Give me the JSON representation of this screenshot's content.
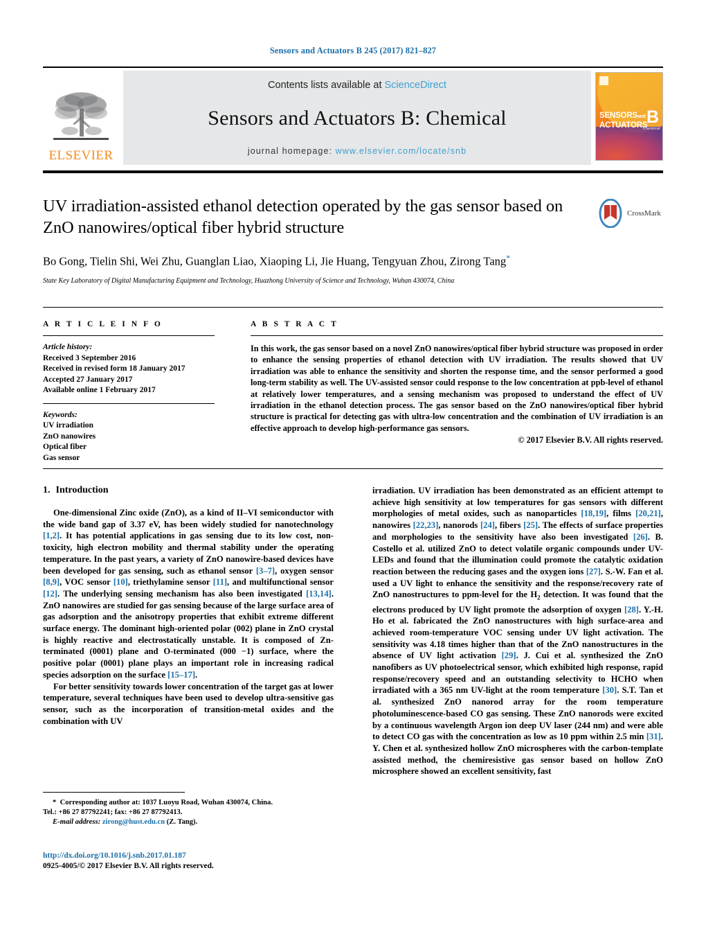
{
  "running_head": "Sensors and Actuators B 245 (2017) 821–827",
  "masthead": {
    "publisher": "ELSEVIER",
    "contents_prefix": "Contents lists available at ",
    "contents_link": "ScienceDirect",
    "journal_title": "Sensors and Actuators B: Chemical",
    "homepage_prefix": "journal homepage: ",
    "homepage_url": "www.elsevier.com/locate/snb",
    "cover": {
      "line1": "SENSORS",
      "line1_small": "and",
      "line2": "ACTUATORS",
      "letter": "B",
      "letter_sub": "Chemical"
    },
    "link_color": "#3f9fd0"
  },
  "article": {
    "title": "UV irradiation-assisted ethanol detection operated by the gas sensor based on ZnO nanowires/optical fiber hybrid structure",
    "authors": "Bo Gong, Tielin Shi, Wei Zhu, Guanglan Liao, Xiaoping Li, Jie Huang, Tengyuan Zhou, Zirong Tang",
    "corresponding_marker": "*",
    "affiliation": "State Key Laboratory of Digital Manufacturing Equipment and Technology, Huazhong University of Science and Technology, Wuhan 430074, China",
    "crossmark_label": "CrossMark"
  },
  "article_info": {
    "heading": "A R T I C L E   I N F O",
    "history_label": "Article history:",
    "history": [
      "Received 3 September 2016",
      "Received in revised form 18 January 2017",
      "Accepted 27 January 2017",
      "Available online 1 February 2017"
    ],
    "keywords_label": "Keywords:",
    "keywords": [
      "UV irradiation",
      "ZnO nanowires",
      "Optical fiber",
      "Gas sensor"
    ]
  },
  "abstract": {
    "heading": "A B S T R A C T",
    "text": "In this work, the gas sensor based on a novel ZnO nanowires/optical fiber hybrid structure was proposed in order to enhance the sensing properties of ethanol detection with UV irradiation. The results showed that UV irradiation was able to enhance the sensitivity and shorten the response time, and the sensor performed a good long-term stability as well. The UV-assisted sensor could response to the low concentration at ppb-level of ethanol at relatively lower temperatures, and a sensing mechanism was proposed to understand the effect of UV irradiation in the ethanol detection process. The gas sensor based on the ZnO nanowires/optical fiber hybrid structure is practical for detecting gas with ultra-low concentration and the combination of UV irradiation is an effective approach to develop high-performance gas sensors.",
    "copyright": "© 2017 Elsevier B.V. All rights reserved."
  },
  "body": {
    "section_number": "1.",
    "section_title": "Introduction",
    "left_paragraph_1_a": "One-dimensional Zinc oxide (ZnO), as a kind of II–VI semiconductor with the wide band gap of 3.37 eV, has been widely studied for nanotechnology ",
    "ref_1_2": "[1,2]",
    "left_paragraph_1_b": ". It has potential applications in gas sensing due to its low cost, non-toxicity, high electron mobility and thermal stability under the operating temperature. In the past years, a variety of ZnO nanowire-based devices have been developed for gas sensing, such as ethanol sensor ",
    "ref_3_7": "[3–7]",
    "left_paragraph_1_c": ", oxygen sensor ",
    "ref_8_9": "[8,9]",
    "left_paragraph_1_d": ", VOC sensor ",
    "ref_10": "[10]",
    "left_paragraph_1_e": ", triethylamine sensor ",
    "ref_11": "[11]",
    "left_paragraph_1_f": ", and multifunctional sensor ",
    "ref_12": "[12]",
    "left_paragraph_1_g": ". The underlying sensing mechanism has also been investigated ",
    "ref_13_14": "[13,14]",
    "left_paragraph_1_h": ". ZnO nanowires are studied for gas sensing because of the large surface area of gas adsorption and the anisotropy properties that exhibit extreme different surface energy. The dominant high-oriented polar (002) plane in ZnO crystal is highly reactive and electrostatically unstable. It is composed of Zn-terminated (0001) plane and O-terminated (000 −1) surface, where the positive polar (0001) plane plays an important role in increasing radical species adsorption on the surface ",
    "ref_15_17": "[15–17]",
    "left_paragraph_1_i": ".",
    "left_paragraph_2": "For better sensitivity towards lower concentration of the target gas at lower temperature, several techniques have been used to develop ultra-sensitive gas sensor, such as the incorporation of transition-metal oxides and the combination with UV",
    "right_paragraph_a": "irradiation. UV irradiation has been demonstrated as an efficient attempt to achieve high sensitivity at low temperatures for gas sensors with different morphologies of metal oxides, such as nanoparticles ",
    "ref_18_19": "[18,19]",
    "right_paragraph_b": ", films ",
    "ref_20_21": "[20,21]",
    "right_paragraph_c": ", nanowires ",
    "ref_22_23": "[22,23]",
    "right_paragraph_d": ", nanorods ",
    "ref_24": "[24]",
    "right_paragraph_e": ", fibers ",
    "ref_25": "[25]",
    "right_paragraph_f": ". The effects of surface properties and morphologies to the sensitivity have also been investigated ",
    "ref_26": "[26]",
    "right_paragraph_g": ". B. Costello et al. utilized ZnO to detect volatile organic compounds under UV-LEDs and found that the illumination could promote the catalytic oxidation reaction between the reducing gases and the oxygen ions ",
    "ref_27": "[27]",
    "right_paragraph_h": ". S.-W. Fan et al. used a UV light to enhance the sensitivity and the response/recovery rate of ZnO nanostructures to ppm-level for the H",
    "h2_sub": "2",
    "right_paragraph_i": " detection. It was found that the electrons produced by UV light promote the adsorption of oxygen ",
    "ref_28": "[28]",
    "right_paragraph_j": ". Y.-H. Ho et al. fabricated the ZnO nanostructures with high surface-area and achieved room-temperature VOC sensing under UV light activation. The sensitivity was 4.18 times higher than that of the ZnO nanostructures in the absence of UV light activation ",
    "ref_29": "[29]",
    "right_paragraph_k": ". J. Cui et al. synthesized the ZnO nanofibers as UV photoelectrical sensor, which exhibited high response, rapid response/recovery speed and an outstanding selectivity to HCHO when irradiated with a 365 nm UV-light at the room temperature ",
    "ref_30": "[30]",
    "right_paragraph_l": ". S.T. Tan et al. synthesized ZnO nanorod array for the room temperature photoluminescence-based CO gas sensing. These ZnO nanorods were excited by a continuous wavelength Argon ion deep UV laser (244 nm) and were able to detect CO gas with the concentration as low as 10 ppm within 2.5 min ",
    "ref_31": "[31]",
    "right_paragraph_m": ". Y. Chen et al. synthesized hollow ZnO microspheres with the carbon-template assisted method, the chemiresistive gas sensor based on hollow ZnO microsphere showed an excellent sensitivity, fast"
  },
  "footnote": {
    "marker": "*",
    "corresponding": "Corresponding author at: 1037 Luoyu Road, Wuhan 430074, China.",
    "tel_fax": "Tel.: +86 27 87792241; fax: +86 27 87792413.",
    "email_label": "E-mail address:",
    "email": "zirong@hust.edu.cn",
    "email_owner": "(Z. Tang).",
    "doi": "http://dx.doi.org/10.1016/j.snb.2017.01.187",
    "issn_line": "0925-4005/© 2017 Elsevier B.V. All rights reserved."
  },
  "colors": {
    "link": "#1a6ea8",
    "elsevier_orange": "#f08a1d",
    "masthead_grey": "#e6e7e8"
  }
}
